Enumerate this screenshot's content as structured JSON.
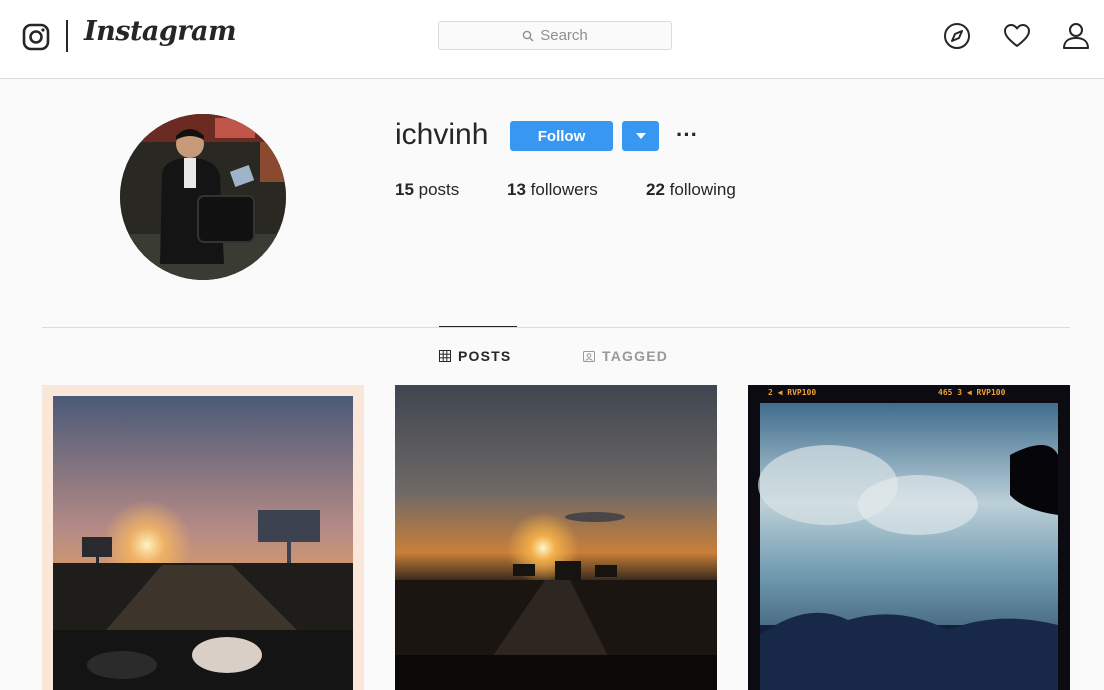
{
  "nav": {
    "wordmark": "Instagram",
    "search_placeholder": "Search",
    "icons": [
      "instagram-glyph-icon",
      "explore-compass-icon",
      "activity-heart-icon",
      "profile-person-icon"
    ]
  },
  "profile": {
    "username": "ichvinh",
    "follow_label": "Follow",
    "more_label": "···",
    "stats": {
      "posts_count": "15",
      "posts_label": " posts",
      "followers_count": "13",
      "followers_label": " followers",
      "following_count": "22",
      "following_label": " following"
    }
  },
  "tabs": [
    {
      "label": "POSTS",
      "active": true,
      "icon": "grid-icon"
    },
    {
      "label": "TAGGED",
      "active": false,
      "icon": "tag-portrait-icon"
    }
  ],
  "posts": {
    "post3_overlay_left": "2 ◀  RVP100",
    "post3_overlay_right": "465  3 ◀  RVP100"
  },
  "colors": {
    "accent": "#3897f0",
    "text": "#262626",
    "muted": "#8e8e8e",
    "border": "#dbdbdb",
    "background": "#fafafa"
  }
}
